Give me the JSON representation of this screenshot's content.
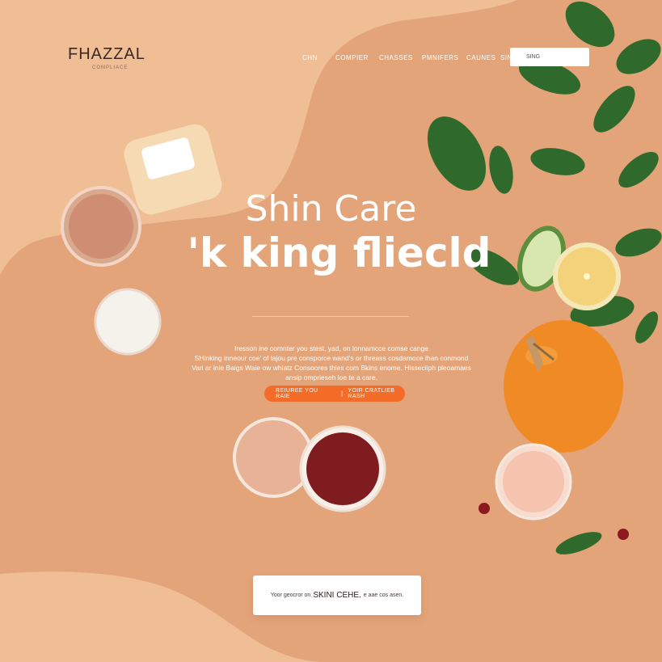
{
  "brand": {
    "name": "FHAZZAL",
    "tagline": "COMPLIACE"
  },
  "nav": {
    "items": [
      "CHN",
      "COMPIER",
      "CHASSES",
      "PMNIFERS",
      "CAUNES",
      "SIN"
    ]
  },
  "search": {
    "value": "SING"
  },
  "hero": {
    "title_line1": "Shin Care",
    "title_line2": "'k king fliecld",
    "description": [
      "Iresson ine comnter you stest, yad, on lonnamcce comse cange",
      "SHinking inneour coe' of lajou pre consporce wand's or threass cosdamoce lhan conmond",
      "Vari ar inie Baigs Waie ow whiatz Consoores thies com Bkins enome. Hisseciiph pleoamaes",
      "ansip omprieseh loe te a care."
    ]
  },
  "cta": {
    "primary": "REIUREE YOU RAIE",
    "secondary": "YOIR CRATLIEB RASH"
  },
  "footer_card": {
    "prefix": "Yoor geocror on",
    "emphasis": "SKINI CEHE.",
    "suffix": "e aae cos asen."
  },
  "colors": {
    "background": "#E3A479",
    "wave": "#F0BE95",
    "accent": "#F36C28",
    "leaf": "#2F6A2C",
    "orange": "#F08A24"
  }
}
